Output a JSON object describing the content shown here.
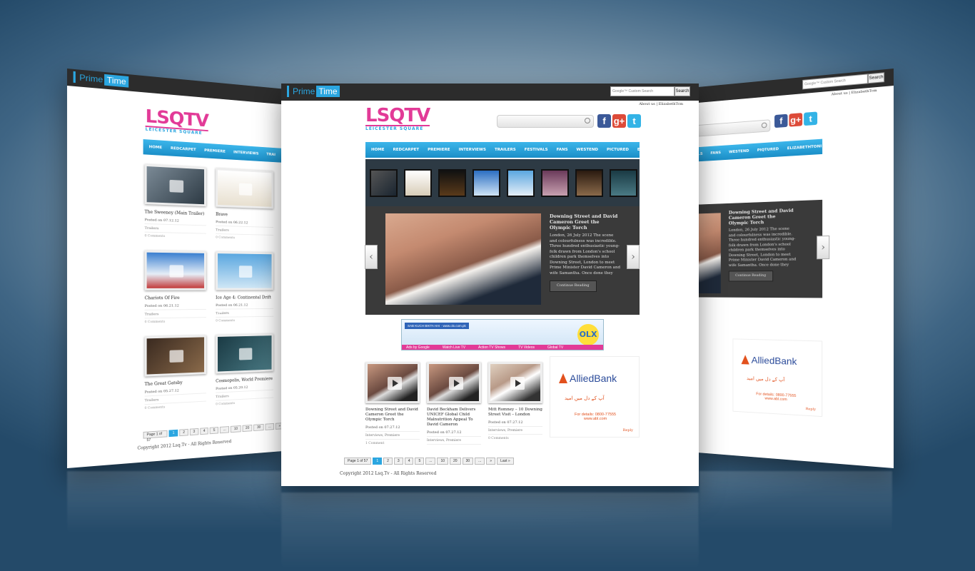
{
  "brand": {
    "part1": "Prime",
    "part2": "Time"
  },
  "topbar": {
    "google_placeholder": "Google™ Custom Search",
    "search_button": "Search",
    "links": "About us | ElizabethTcm"
  },
  "logo": {
    "main": "LSQTV",
    "sub": "LEICESTER SQUARE"
  },
  "social": {
    "facebook": "f",
    "google": "g+",
    "twitter": "t"
  },
  "nav": [
    "HOME",
    "REDCARPET",
    "PREMIERE",
    "INTERVIEWS",
    "TRAILERS",
    "FESTIVALS",
    "FANS",
    "WESTEND",
    "PICTURED",
    "ELIZABETHTONI"
  ],
  "left_nav": [
    "HOME",
    "REDCARPET",
    "PREMIERE",
    "INTERVIEWS",
    "TRAI"
  ],
  "right_nav": [
    "...S",
    "FANS",
    "WESTEND",
    "PIQTURED",
    "ELIZABETHTONI"
  ],
  "feature": {
    "title": "Downing Street and David Cameron Greet the Olympic Torch",
    "body": "London, 26 July 2012 The scene and colourfulness was incredible. Three hundred enthusiastic young-folk drawn from London's school children park themselves into Downing Street, London to meet Prime Minister David Cameron and wife Samantha. Once done they greet the Olympic flame and cheer its transfer as it makes its way ...",
    "button": "Continue Reading",
    "prev_arrow": "‹",
    "next_arrow": "›"
  },
  "ad_bar": {
    "headline": "SAB KUCH BIKTA HAI",
    "site": "www.olx.com.pk",
    "logo": "OLX",
    "links": [
      "Ads by Google",
      "Watch Live TV",
      "Action TV Shows",
      "TV Videos",
      "Global TV"
    ]
  },
  "posts": [
    {
      "title": "Downing Street and David Cameron Greet the Olympic Torch",
      "date": "Posted on 07.27.12",
      "cats": "Interviews, Premiere",
      "comments": "1 Comment"
    },
    {
      "title": "David Beckham Delivers UNICEF Global Child Malnutrition Appeal To David Cameron",
      "date": "Posted on 07.27.12",
      "cats": "Interviews, Premiere",
      "comments": ""
    },
    {
      "title": "Mitt Romney – 10 Downing Street Visit – London",
      "date": "Posted on 07.27.12",
      "cats": "Interviews, Premiere",
      "comments": "0 Comments"
    }
  ],
  "allied": {
    "name": "AlliedBank",
    "urdu": "آپ کے دل میں امید",
    "details": "For details: 0800-77555",
    "site": "www.abl.com",
    "reply": "Reply"
  },
  "pager": [
    "Page 1 of 57",
    "1",
    "2",
    "3",
    "4",
    "5",
    "...",
    "10",
    "20",
    "30",
    "...",
    "»",
    "Last »"
  ],
  "left_pager": [
    "Page 1 of 57",
    "1",
    "2",
    "3",
    "4",
    "5",
    "...",
    "10",
    "20",
    "30",
    "...",
    "»"
  ],
  "copyright": "Copyright 2012 Lsq.Tv - All Rights Reserved",
  "left_grid": [
    {
      "title": "The Sweeney (Main Trailer)",
      "date": "Posted on 07.12.12",
      "cat": "Trailers",
      "comments": "0 Comments"
    },
    {
      "title": "Brave",
      "date": "Posted on 06.22.12",
      "cat": "Trailers",
      "comments": "0 Comments"
    },
    {
      "title": "Chariots Of Fire",
      "date": "Posted on 06.21.12",
      "cat": "Trailers",
      "comments": "0 Comments"
    },
    {
      "title": "Ice Age 4: Continental Drift",
      "date": "Posted on 06.21.12",
      "cat": "Trailers",
      "comments": "0 Comments"
    },
    {
      "title": "The Great Gatsby",
      "date": "Posted on 05.27.12",
      "cat": "Trailers",
      "comments": "0 Comments"
    },
    {
      "title": "Cosmopolis, World Premiere",
      "date": "Posted on 05.20.12",
      "cat": "Trailers",
      "comments": "0 Comments"
    }
  ]
}
